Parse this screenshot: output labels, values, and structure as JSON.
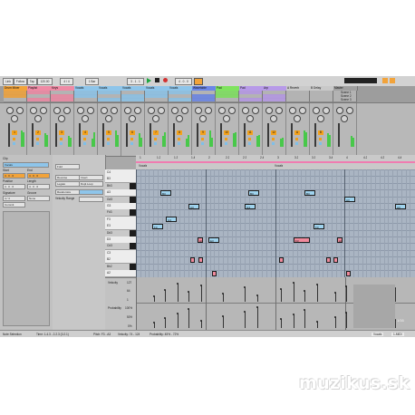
{
  "transport": {
    "link": "Link",
    "follow": "Follow",
    "tap": "Tap",
    "tempo": "120.00",
    "signature": "4 / 4",
    "metro": "1 Bar",
    "position": "3 . 1 . 1",
    "quant": "4 . 0 . 0",
    "zoom": "1/16"
  },
  "tracks": [
    {
      "name": "Drum Mixer",
      "color": "#f2a33a"
    },
    {
      "name": "Playlist",
      "color": "#ef8aa5"
    },
    {
      "name": "Keys",
      "color": "#ef8aa5"
    },
    {
      "name": "Vocals",
      "color": "#8ec5ea"
    },
    {
      "name": "Vocals",
      "color": "#8ec5ea"
    },
    {
      "name": "Vocals",
      "color": "#8ec5ea"
    },
    {
      "name": "Vocals",
      "color": "#8ec5ea"
    },
    {
      "name": "Vocals",
      "color": "#8ec5ea"
    },
    {
      "name": "Wavetable",
      "color": "#6b86e8"
    },
    {
      "name": "Pad",
      "color": "#7fe35f"
    },
    {
      "name": "Pad",
      "color": "#b79ae8"
    },
    {
      "name": "Arp",
      "color": "#b79ae8"
    },
    {
      "name": "A Reverb",
      "color": "#c9c9c9"
    },
    {
      "name": "B Delay",
      "color": "#c9c9c9"
    },
    {
      "name": "Master",
      "color": "#a0a0a0"
    }
  ],
  "scenes": [
    "Scene 1",
    "Scene 2",
    "Scene 3"
  ],
  "trackNumbers": [
    "1",
    "2",
    "3",
    "4",
    "5",
    "6",
    "7",
    "8",
    "9",
    "10",
    "11",
    "12",
    "A",
    "B"
  ],
  "clip": {
    "title": "Clip",
    "name": "Vocals",
    "start_label": "Start",
    "end_label": "End",
    "position_label": "Position",
    "length_label": "Length",
    "signature_label": "Signature",
    "groove_label": "Groove",
    "signature_value": "4 / 4",
    "groove_value": "None",
    "length_value": "4 . 0 . 0",
    "commit_label": "Commit",
    "reverse_label": "Reverse",
    "invert_label": "Invert",
    "legato_label": "Legato",
    "dupl_label": "Dupl.Loop",
    "randomize_label": "Randomize",
    "vel_range_label": "Velocity Range",
    "fold_label": "Fold"
  },
  "pianoKeys": [
    "C4",
    "B3",
    "Bb3",
    "A3",
    "G#3",
    "G3",
    "F#3",
    "F3",
    "E3",
    "D#3",
    "D3",
    "C#3",
    "C3",
    "B2",
    "Bb2",
    "A2"
  ],
  "notes": [
    {
      "label": "B3",
      "color": "blue"
    },
    {
      "label": "A3",
      "color": "blue"
    },
    {
      "label": "G3",
      "color": "blue"
    },
    {
      "label": "F3",
      "color": "blue"
    },
    {
      "label": "E3",
      "color": "blue"
    },
    {
      "label": "A3",
      "color": "pink"
    },
    {
      "label": "B3",
      "color": "blue"
    },
    {
      "label": "A3",
      "color": "blue"
    },
    {
      "label": "G3",
      "color": "blue"
    },
    {
      "label": "F3",
      "color": "blue"
    },
    {
      "label": "A3",
      "color": "blue"
    },
    {
      "label": "B3",
      "color": "blue"
    },
    {
      "label": "F3",
      "color": "pink"
    },
    {
      "label": "A3",
      "color": "pink"
    }
  ],
  "ruler_marks": [
    "1",
    "1.2",
    "1.3",
    "1.4",
    "2",
    "2.2",
    "2.3",
    "2.4",
    "3",
    "3.2",
    "3.3",
    "3.4",
    "4",
    "4.2",
    "4.3",
    "4.4"
  ],
  "lanes": {
    "velocity": "Velocity",
    "probability": "Probability",
    "vel_ticks": [
      "127",
      "64",
      "1"
    ],
    "prob_ticks": [
      "100%",
      "50%",
      "0%"
    ]
  },
  "status": {
    "selection": "Note Selection",
    "time": "Time: 1.4.3 - 2.2.3 (0.2.1)",
    "pitch": "Pitch: F3 - A3",
    "velocity": "Velocity: 74 - 124",
    "probability": "Probability: 45% - 72%",
    "track": "Vocals",
    "midi": "1-MIDI"
  },
  "watermark": "muzikus.sk"
}
